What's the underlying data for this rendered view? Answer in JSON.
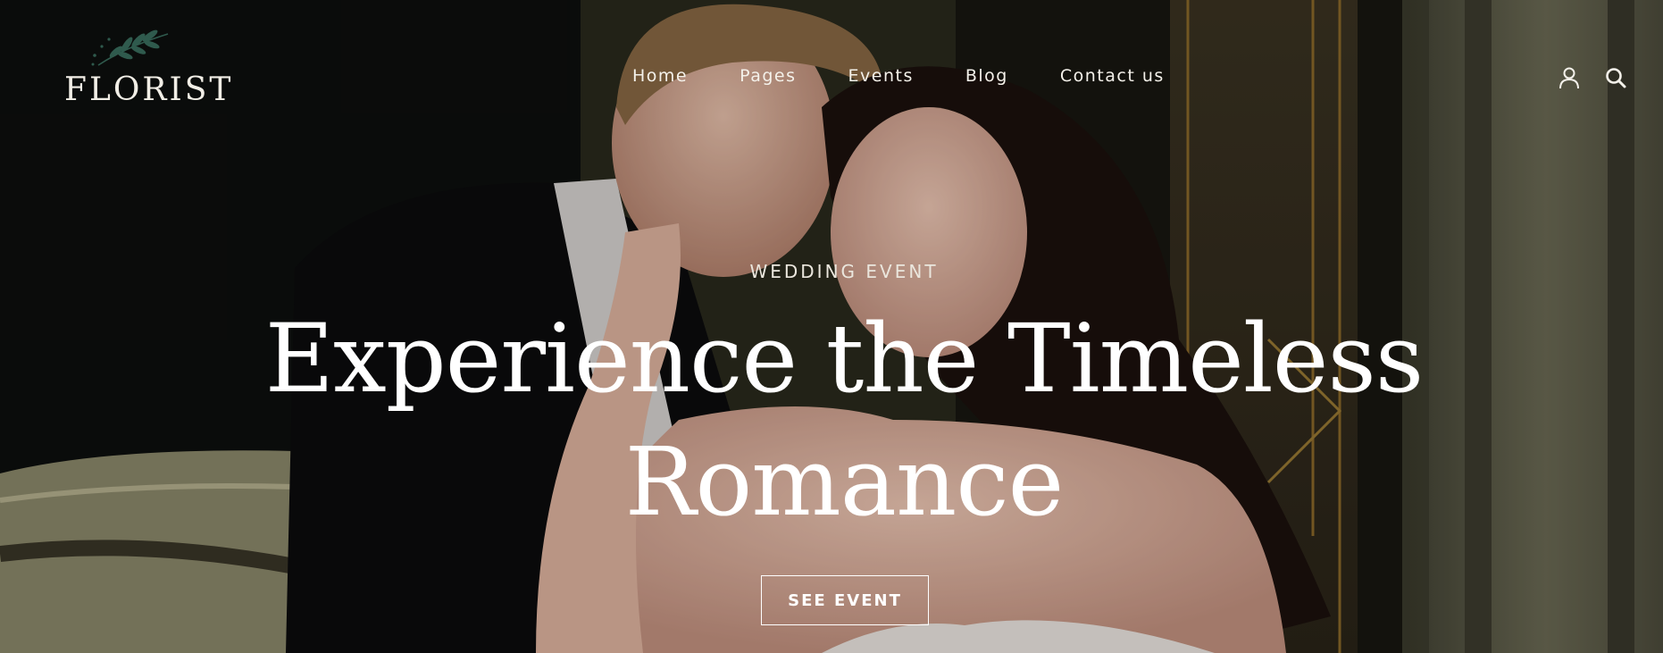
{
  "brand": {
    "name": "FLORIST",
    "logo_icon": "olive-branch-icon",
    "accent_color": "#2f5a4d"
  },
  "nav": {
    "items": [
      {
        "label": "Home"
      },
      {
        "label": "Pages"
      },
      {
        "label": "Events"
      },
      {
        "label": "Blog"
      },
      {
        "label": "Contact us"
      }
    ]
  },
  "header_icons": {
    "account": "user-icon",
    "search": "search-icon"
  },
  "hero": {
    "eyebrow": "WEDDING EVENT",
    "title_line1": "Experience the Timeless",
    "title_line2": "Romance",
    "cta_label": "SEE EVENT",
    "image_subject": "couple-photo"
  },
  "colors": {
    "text": "#ffffff",
    "overlay": "#000000"
  }
}
